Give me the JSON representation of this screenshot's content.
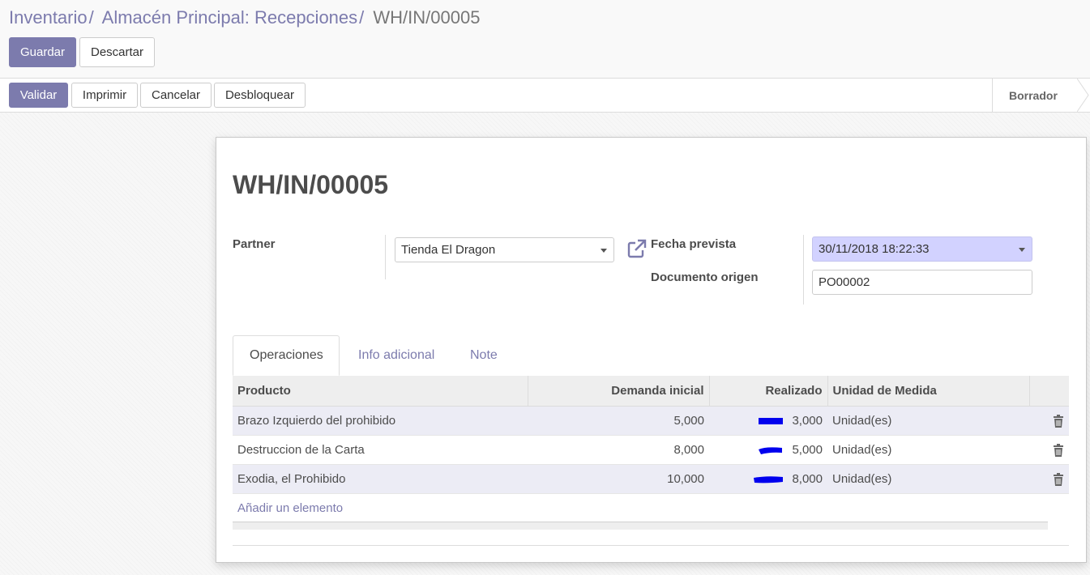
{
  "breadcrumb": {
    "items": [
      "Inventario",
      "Almacén Principal: Recepciones"
    ],
    "current": "WH/IN/00005",
    "separator": "/"
  },
  "actions": {
    "save_label": "Guardar",
    "discard_label": "Descartar"
  },
  "statusbar": {
    "validate_label": "Validar",
    "print_label": "Imprimir",
    "cancel_label": "Cancelar",
    "unlock_label": "Desbloquear",
    "stage": "Borrador"
  },
  "form": {
    "title": "WH/IN/00005",
    "partner_label": "Partner",
    "partner_value": "Tienda El Dragon",
    "scheduled_date_label": "Fecha prevista",
    "scheduled_date_value": "30/11/2018 18:22:33",
    "origin_label": "Documento origen",
    "origin_value": "PO00002"
  },
  "tabs": [
    {
      "label": "Operaciones",
      "active": true
    },
    {
      "label": "Info adicional",
      "active": false
    },
    {
      "label": "Note",
      "active": false
    }
  ],
  "table": {
    "headers": [
      "Producto",
      "Demanda inicial",
      "Realizado",
      "Unidad de Medida"
    ],
    "rows": [
      {
        "product": "Brazo Izquierdo del prohibido",
        "demand": "5,000",
        "done": "3,000",
        "uom": "Unidad(es)"
      },
      {
        "product": "Destruccion de la Carta",
        "demand": "8,000",
        "done": "5,000",
        "uom": "Unidad(es)"
      },
      {
        "product": "Exodia, el Prohibido",
        "demand": "10,000",
        "done": "8,000",
        "uom": "Unidad(es)"
      }
    ],
    "add_line_label": "Añadir un elemento"
  },
  "colors": {
    "brand": "#7c7bad",
    "required_field": "#d2d2ff",
    "scribble": "#0000ee"
  },
  "icons": [
    "external-link-icon",
    "caret-down-icon",
    "trash-icon"
  ]
}
